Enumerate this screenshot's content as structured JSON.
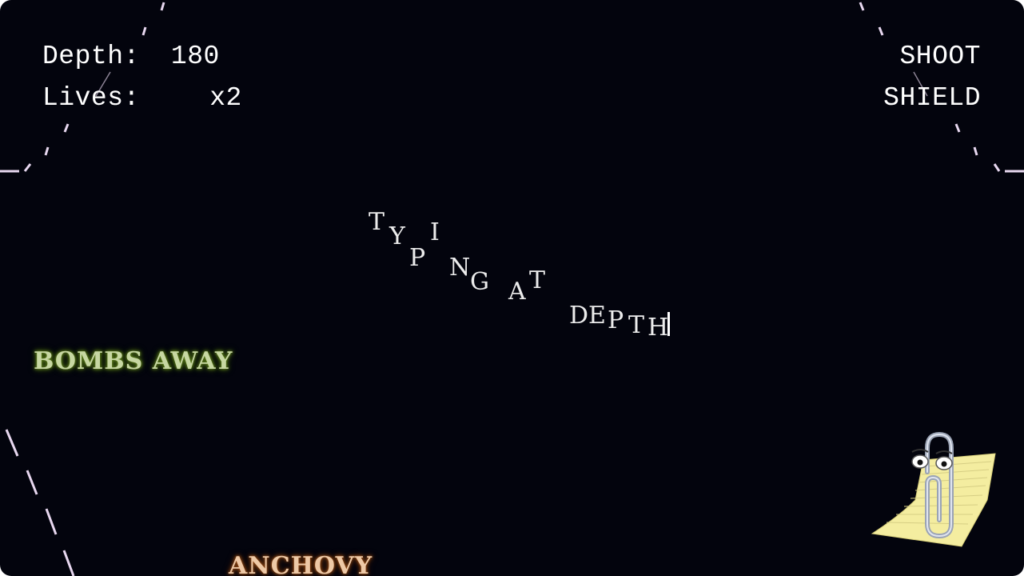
{
  "hud": {
    "depth_label": "Depth:",
    "depth_value": "180",
    "lives_label": "Lives:",
    "lives_value": "x2"
  },
  "actions": [
    "SHOOT",
    "SHIELD"
  ],
  "title_text": "TYPING AT DEPTH",
  "words": [
    {
      "text": "BOMBS AWAY",
      "color": "#c7d7a2",
      "glow": "#6b8d23"
    },
    {
      "text": "ANCHOVY",
      "color": "#eec9a6",
      "glow": "#a2541b"
    }
  ],
  "colors": {
    "background": "#03040d",
    "tunnel": "#e8d8f0",
    "text": "#ffffff"
  },
  "icons": [
    "clippy-assistant-icon"
  ]
}
